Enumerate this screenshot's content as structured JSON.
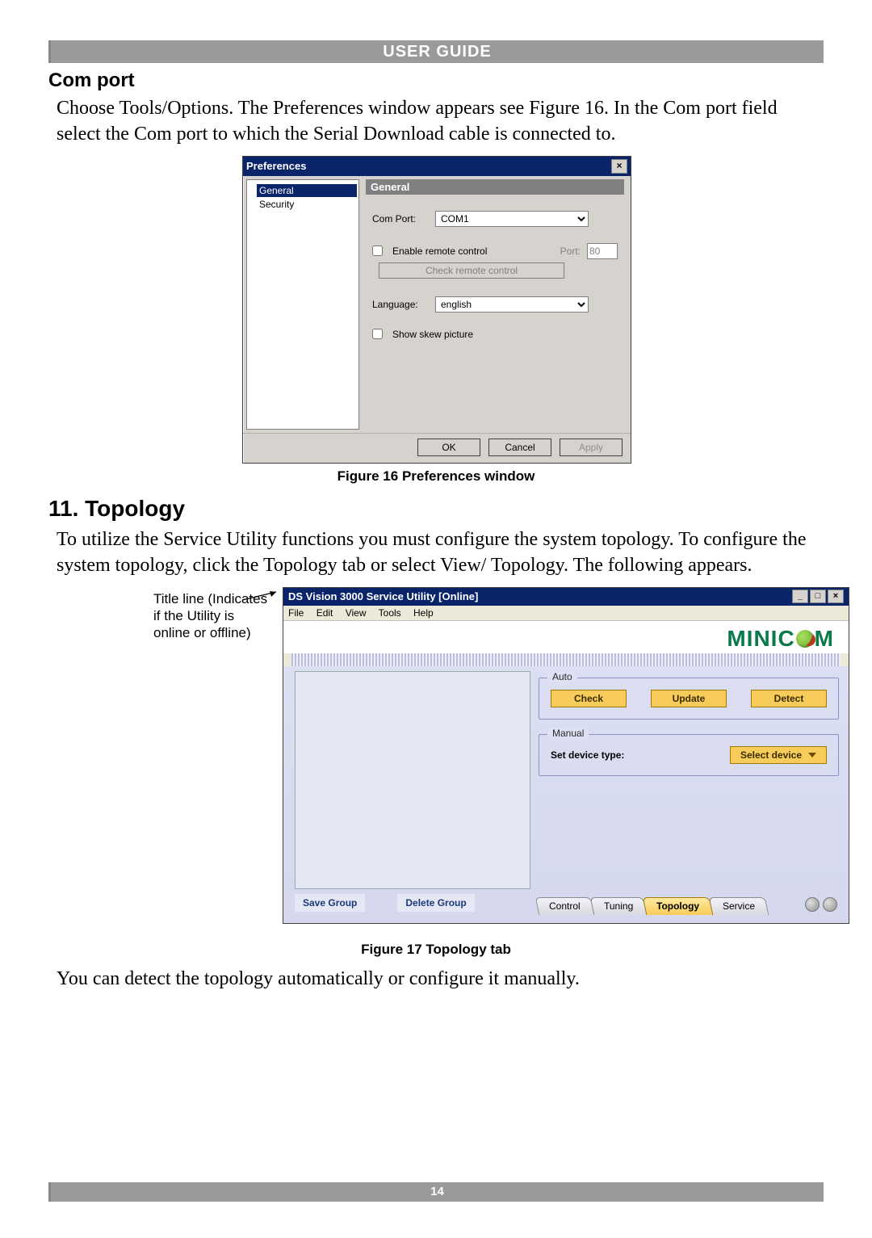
{
  "header": "USER GUIDE",
  "page_number": "14",
  "section1": {
    "heading": "Com port",
    "para": "Choose Tools/Options. The Preferences window appears see Figure 16. In the Com port field select the Com port to which the Serial Download cable is connected to."
  },
  "fig16_caption": "Figure 16 Preferences window",
  "prefs": {
    "title": "Preferences",
    "tree": {
      "general": "General",
      "security": "Security"
    },
    "panel_title": "General",
    "com_port_label": "Com Port:",
    "com_port_value": "COM1",
    "enable_remote": "Enable remote control",
    "port_label": "Port:",
    "port_value": "80",
    "check_remote": "Check remote control",
    "language_label": "Language:",
    "language_value": "english",
    "show_skew": "Show skew picture",
    "ok": "OK",
    "cancel": "Cancel",
    "apply": "Apply"
  },
  "section2": {
    "heading": "11. Topology",
    "para1": "To utilize the Service Utility functions you must configure the system topology. To configure the system topology, click the Topology tab or select View/ Topology. The following appears.",
    "para2": "You can detect the topology automatically or configure it manually."
  },
  "callout": "Title line (Indicates if the Utility is online or offline)",
  "fig17_caption": "Figure 17 Topology tab",
  "topo": {
    "title": "DS Vision 3000 Service Utility [Online]",
    "menu": {
      "file": "File",
      "edit": "Edit",
      "view": "View",
      "tools": "Tools",
      "help": "Help"
    },
    "brand_left": "MINIC",
    "brand_right": "M",
    "auto_legend": "Auto",
    "manual_legend": "Manual",
    "btn_check": "Check",
    "btn_update": "Update",
    "btn_detect": "Detect",
    "set_device": "Set device type:",
    "select_device": "Select device",
    "save_group": "Save Group",
    "delete_group": "Delete Group",
    "tabs": {
      "control": "Control",
      "tuning": "Tuning",
      "topology": "Topology",
      "service": "Service"
    }
  }
}
